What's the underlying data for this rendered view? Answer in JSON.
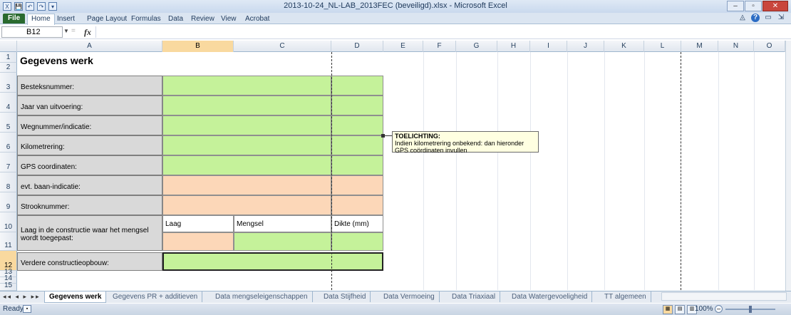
{
  "window": {
    "title": "2013-10-24_NL-LAB_2013FEC (beveiligd).xlsx - Microsoft Excel",
    "controls": [
      "–",
      "▫",
      "✕"
    ]
  },
  "quick_access": [
    "X",
    "💾",
    "↶",
    "↷",
    "▾"
  ],
  "ribbon": {
    "tabs": [
      "File",
      "Home",
      "Insert",
      "Page Layout",
      "Formulas",
      "Data",
      "Review",
      "View",
      "Acrobat"
    ],
    "active": "Home",
    "help_icons": [
      "◬",
      "?",
      "▭",
      "⇲"
    ]
  },
  "formula_bar": {
    "name_box": "B12",
    "fx": "fx",
    "formula": ""
  },
  "columns": [
    "A",
    "B",
    "C",
    "D",
    "E",
    "F",
    "G",
    "H",
    "I",
    "J",
    "K",
    "L",
    "M",
    "N",
    "O"
  ],
  "selected_column": "B",
  "rows": [
    "1",
    "2",
    "3",
    "4",
    "5",
    "6",
    "7",
    "8",
    "9",
    "10",
    "11",
    "12",
    "13",
    "14",
    "15"
  ],
  "selected_row": "12",
  "sheet": {
    "title": "Gegevens werk",
    "labels": {
      "besteknummer": "Besteksnummer:",
      "jaar": "Jaar van uitvoering:",
      "wegnummer": "Wegnummer/indicatie:",
      "kilometrering": "Kilometrering:",
      "gps": "GPS coordinaten:",
      "baan": "evt. baan-indicatie:",
      "strook": "Strooknummer:",
      "laag": "Laag in de constructie waar het mengsel wordt toegepast:",
      "verdere": "Verdere constructieopbouw:"
    },
    "subheaders": {
      "laag": "Laag",
      "mengsel": "Mengsel",
      "dikte": "Dikte (mm)"
    }
  },
  "comment": {
    "heading": "TOELICHTING:",
    "body": "Indien kilometrering onbekend: dan hieronder GPS coördinaten invullen"
  },
  "sheet_tabs": {
    "nav": "◂◂ ◂ ▸ ▸▸",
    "tabs": [
      "Gegevens werk",
      "Gegevens PR + additieven",
      "Data mengseleigenschappen",
      "Data Stijfheid",
      "Data Vermoeing",
      "Data Triaxiaal",
      "Data Watergevoeligheid",
      "TT algemeen"
    ],
    "active": "Gegevens werk"
  },
  "status": {
    "text": "Ready",
    "zoom": "100%",
    "zoom_fraction": 0.5
  },
  "colors": {
    "green": "#c5f29a",
    "peach": "#fcd7b8",
    "label_gray": "#d9d9d9",
    "selected_header": "#f9d99f"
  }
}
